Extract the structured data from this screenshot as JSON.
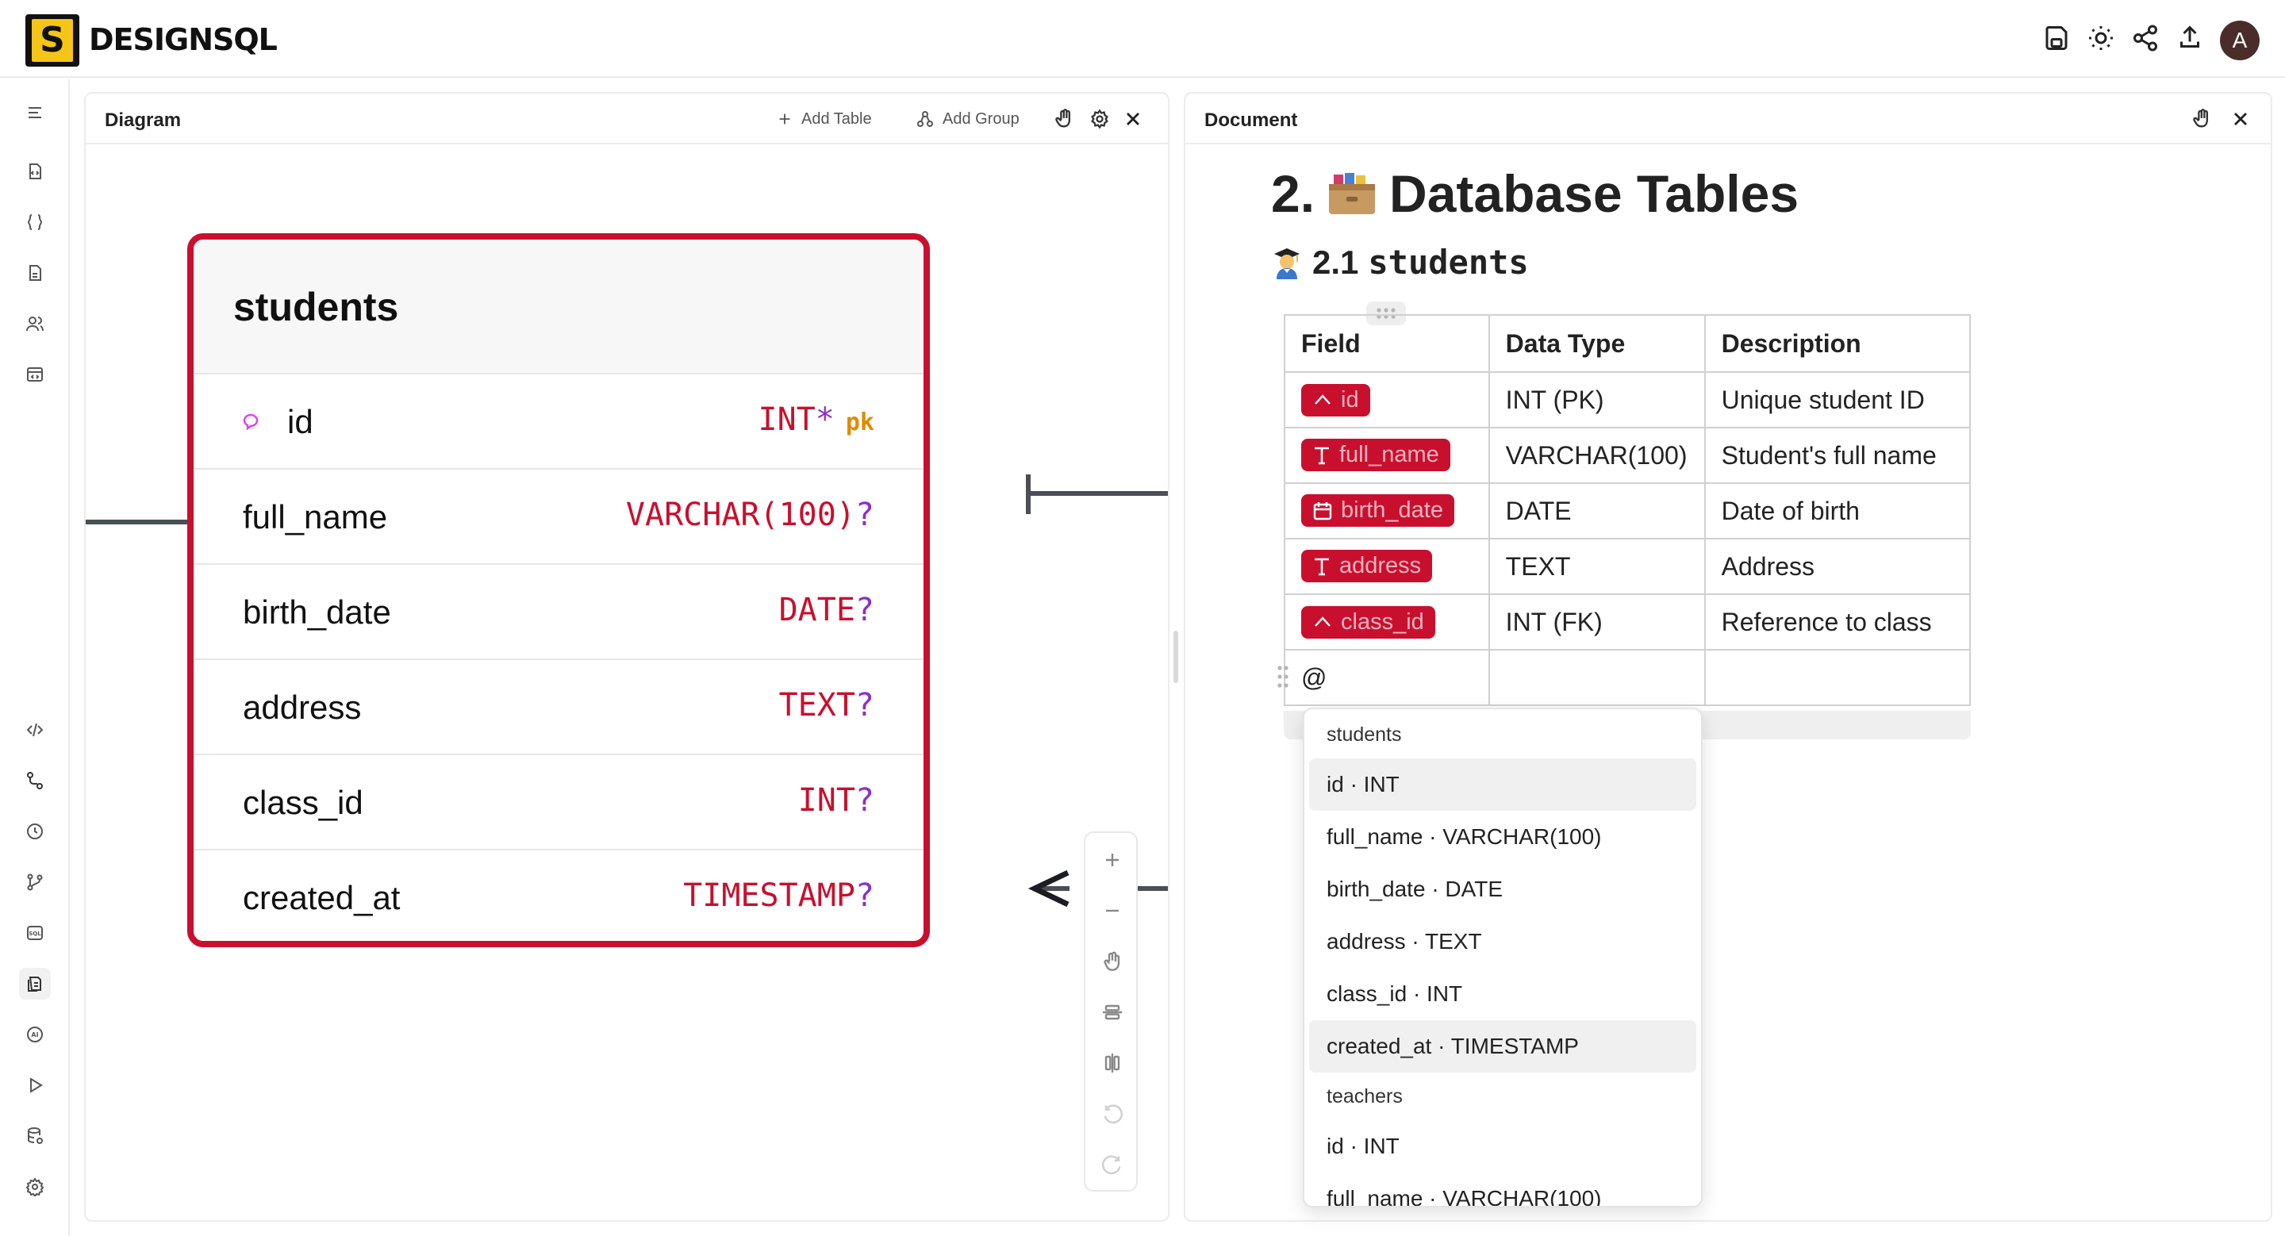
{
  "app": {
    "logo_letter": "S",
    "name": "DESIGNSQL"
  },
  "topbar": {
    "avatar_initial": "A",
    "icons": [
      "save-icon",
      "theme-sun-icon",
      "share-icon",
      "export-icon"
    ]
  },
  "left_rail": {
    "icons": [
      "menu-icon",
      "tables-icon",
      "braces-icon",
      "tables-alt-icon",
      "users-icon",
      "code-window-icon",
      "code-icon",
      "relations-icon",
      "history-icon",
      "branch-icon",
      "sql-icon",
      "document-icon",
      "ai-icon",
      "run-icon",
      "database-settings-icon",
      "settings-icon"
    ],
    "active": "document-icon"
  },
  "diagram": {
    "title": "Diagram",
    "add_table_label": "Add Table",
    "add_group_label": "Add Group",
    "table": {
      "name": "students",
      "columns": [
        {
          "name": "id",
          "type": "INT",
          "suffix": "*",
          "pk_label": "pk"
        },
        {
          "name": "full_name",
          "type": "VARCHAR(100)",
          "suffix": "?"
        },
        {
          "name": "birth_date",
          "type": "DATE",
          "suffix": "?"
        },
        {
          "name": "address",
          "type": "TEXT",
          "suffix": "?"
        },
        {
          "name": "class_id",
          "type": "INT",
          "suffix": "?"
        },
        {
          "name": "created_at",
          "type": "TIMESTAMP",
          "suffix": "?"
        }
      ]
    }
  },
  "document": {
    "title": "Document",
    "h1_number": "2.",
    "h1_text": "Database Tables",
    "h2_number": "2.1",
    "h2_text": "students",
    "table": {
      "headers": [
        "Field",
        "Data Type",
        "Description"
      ],
      "rows": [
        {
          "field": "id",
          "field_icon": "key-icon",
          "type": "INT (PK)",
          "desc": "Unique student ID"
        },
        {
          "field": "full_name",
          "field_icon": "text-icon",
          "type": "VARCHAR(100)",
          "desc": "Student's full name"
        },
        {
          "field": "birth_date",
          "field_icon": "calendar-icon",
          "type": "DATE",
          "desc": "Date of birth"
        },
        {
          "field": "address",
          "field_icon": "text-icon",
          "type": "TEXT",
          "desc": "Address"
        },
        {
          "field": "class_id",
          "field_icon": "key-icon",
          "type": "INT (FK)",
          "desc": "Reference to class"
        }
      ],
      "input_text": "@"
    },
    "mention_dropdown": {
      "groups": [
        {
          "name": "students",
          "items": [
            "id · INT",
            "full_name · VARCHAR(100)",
            "birth_date · DATE",
            "address · TEXT",
            "class_id · INT",
            "created_at · TIMESTAMP"
          ]
        },
        {
          "name": "teachers",
          "items": [
            "id · INT",
            "full_name · VARCHAR(100)"
          ]
        }
      ]
    }
  },
  "colors": {
    "accent": "#c8102e",
    "type_text": "#c8102e",
    "nullable_mark": "#8b2fc9",
    "pk_tag": "#e08a00",
    "logo_yellow": "#f5c518"
  }
}
